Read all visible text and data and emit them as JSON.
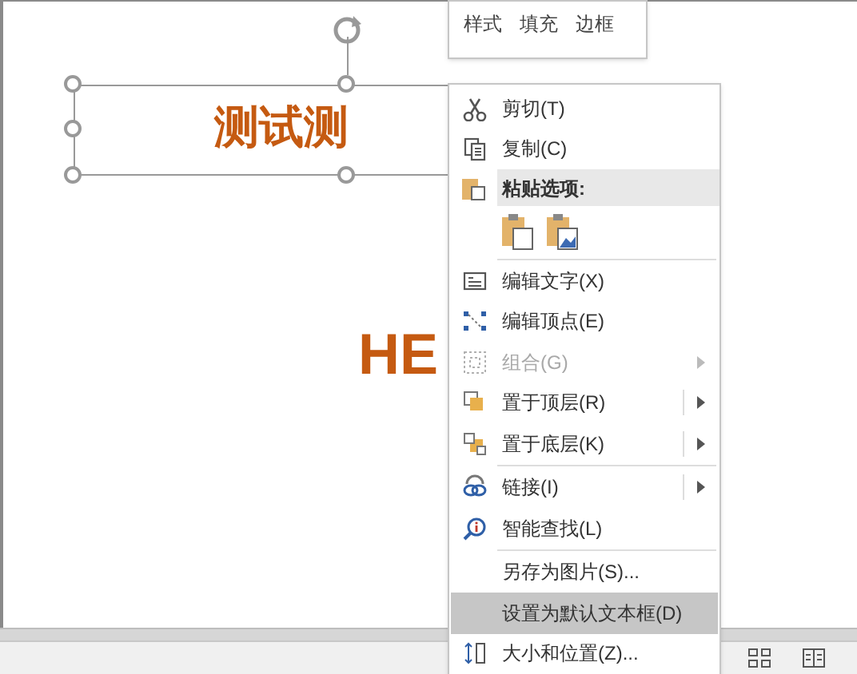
{
  "slide": {
    "title_text": "测试测",
    "body_text": "HE"
  },
  "mini_toolbar": {
    "buttons": [
      "样式",
      "填充",
      "边框"
    ]
  },
  "context_menu": {
    "items": [
      {
        "kind": "item",
        "label": "剪切(T)",
        "disabled": false,
        "submenu": false,
        "selected": false
      },
      {
        "kind": "item",
        "label": "复制(C)",
        "disabled": false,
        "submenu": false,
        "selected": false
      },
      {
        "kind": "header",
        "label": "粘贴选项:"
      },
      {
        "kind": "paste_options"
      },
      {
        "kind": "separator"
      },
      {
        "kind": "item",
        "label": "编辑文字(X)",
        "disabled": false,
        "submenu": false,
        "selected": false
      },
      {
        "kind": "item",
        "label": "编辑顶点(E)",
        "disabled": false,
        "submenu": false,
        "selected": false
      },
      {
        "kind": "item",
        "label": "组合(G)",
        "disabled": true,
        "submenu": true,
        "selected": false
      },
      {
        "kind": "item",
        "label": "置于顶层(R)",
        "disabled": false,
        "submenu": true,
        "selected": false
      },
      {
        "kind": "item",
        "label": "置于底层(K)",
        "disabled": false,
        "submenu": true,
        "selected": false
      },
      {
        "kind": "separator"
      },
      {
        "kind": "item",
        "label": "链接(I)",
        "disabled": false,
        "submenu": true,
        "selected": false
      },
      {
        "kind": "item",
        "label": "智能查找(L)",
        "disabled": false,
        "submenu": false,
        "selected": false
      },
      {
        "kind": "separator"
      },
      {
        "kind": "item",
        "label": "另存为图片(S)...",
        "disabled": false,
        "submenu": false,
        "selected": false
      },
      {
        "kind": "item",
        "label": "设置为默认文本框(D)",
        "disabled": false,
        "submenu": false,
        "selected": true
      },
      {
        "kind": "item",
        "label": "大小和位置(Z)...",
        "disabled": false,
        "submenu": false,
        "selected": false
      }
    ]
  }
}
